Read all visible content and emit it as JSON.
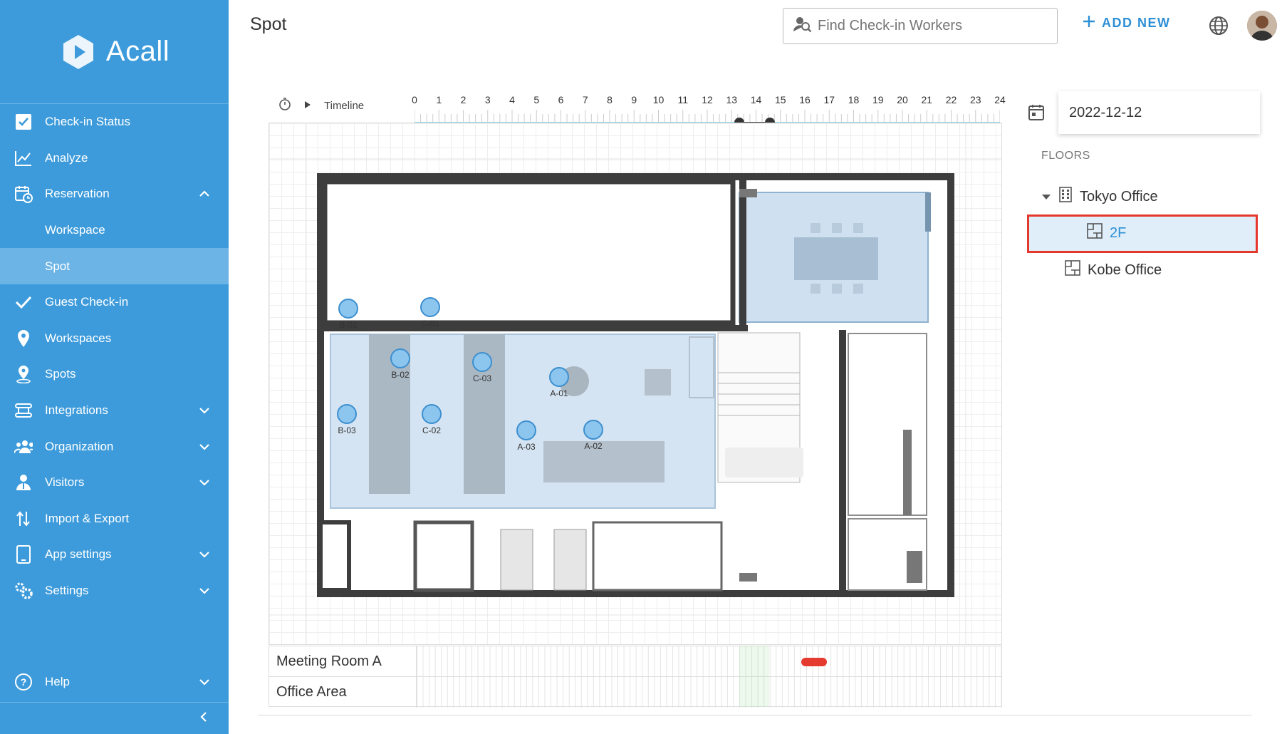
{
  "sidebar": {
    "brand": "Acall",
    "items": [
      {
        "label": "Check-in Status",
        "icon": "checkbox-icon"
      },
      {
        "label": "Analyze",
        "icon": "chart-line-icon"
      },
      {
        "label": "Reservation",
        "icon": "calendar-clock-icon",
        "expanded": true
      },
      {
        "label": "Workspace",
        "sub": true
      },
      {
        "label": "Spot",
        "sub": true,
        "active": true
      },
      {
        "label": "Guest Check-in",
        "icon": "check-icon"
      },
      {
        "label": "Workspaces",
        "icon": "pin-icon"
      },
      {
        "label": "Spots",
        "icon": "location-person-icon"
      },
      {
        "label": "Integrations",
        "icon": "integrations-icon",
        "expandable": true
      },
      {
        "label": "Organization",
        "icon": "people-icon",
        "expandable": true
      },
      {
        "label": "Visitors",
        "icon": "visitor-icon",
        "expandable": true
      },
      {
        "label": "Import & Export",
        "icon": "import-export-icon"
      },
      {
        "label": "App settings",
        "icon": "tablet-icon",
        "expandable": true
      },
      {
        "label": "Settings",
        "icon": "gears-icon",
        "expandable": true
      }
    ],
    "help": "Help"
  },
  "header": {
    "title": "Spot",
    "search_placeholder": "Find Check-in Workers",
    "add_new": "ADD NEW"
  },
  "timeline": {
    "label": "Timeline",
    "hours": [
      "0",
      "1",
      "2",
      "3",
      "4",
      "5",
      "6",
      "7",
      "8",
      "9",
      "10",
      "11",
      "12",
      "13",
      "14",
      "15",
      "16",
      "17",
      "18",
      "19",
      "20",
      "21",
      "22",
      "23",
      "24"
    ],
    "range": [
      13.3,
      14.5
    ]
  },
  "spots": [
    {
      "id": "B-01"
    },
    {
      "id": "C-01"
    },
    {
      "id": "B-02"
    },
    {
      "id": "C-03"
    },
    {
      "id": "A-01"
    },
    {
      "id": "B-03"
    },
    {
      "id": "C-02"
    },
    {
      "id": "A-03"
    },
    {
      "id": "A-02"
    }
  ],
  "reservations": {
    "rows": [
      "Meeting Room A",
      "Office Area"
    ]
  },
  "right_panel": {
    "date": "2022-12-12",
    "floors_title": "FLOORS",
    "tree": {
      "building1": "Tokyo Office",
      "floor_selected": "2F",
      "building2": "Kobe Office"
    }
  },
  "colors": {
    "sidebar": "#3d9bdb",
    "accent": "#2d8fd6",
    "selection_border": "#e5382c",
    "reservation_bar": "#e53a2f"
  }
}
